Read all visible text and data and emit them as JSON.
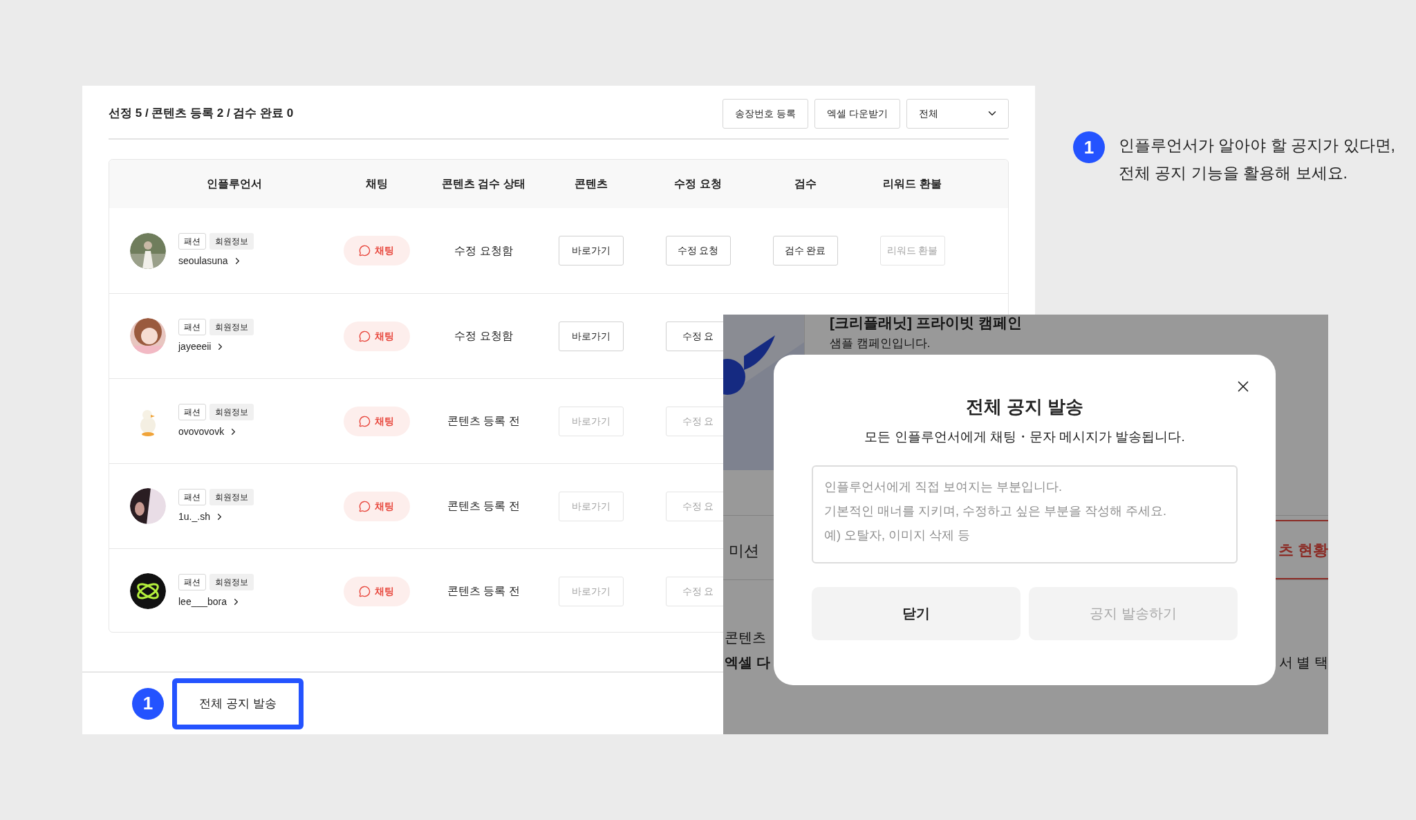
{
  "summary": "선정 5 / 콘텐츠 등록 2 / 검수 완료 0",
  "toolbar": {
    "buttons": [
      "송장번호 등록",
      "엑셀 다운받기"
    ],
    "filter": {
      "value": "전체"
    }
  },
  "table": {
    "columns": [
      "인플루언서",
      "채팅",
      "콘텐츠 검수 상태",
      "콘텐츠",
      "수정 요청",
      "검수",
      "리워드 환불"
    ],
    "rows": [
      {
        "category": "패션",
        "info_tag": "회원정보",
        "username": "seoulasuna",
        "chat": "채팅",
        "status": "수정 요청함",
        "actions": [
          {
            "label": "바로가기",
            "disabled": false
          },
          {
            "label": "수정 요청",
            "disabled": false
          },
          {
            "label": "검수 완료",
            "disabled": false
          },
          {
            "label": "리워드 환불",
            "disabled": true
          }
        ]
      },
      {
        "category": "패션",
        "info_tag": "회원정보",
        "username": "jayeeeii",
        "chat": "채팅",
        "status": "수정 요청함",
        "actions": [
          {
            "label": "바로가기",
            "disabled": false
          },
          {
            "label": "수정 요",
            "disabled": false
          }
        ]
      },
      {
        "category": "패션",
        "info_tag": "회원정보",
        "username": "ovovovovk",
        "chat": "채팅",
        "status": "콘텐츠 등록 전",
        "actions": [
          {
            "label": "바로가기",
            "disabled": true
          },
          {
            "label": "수정 요",
            "disabled": true
          }
        ]
      },
      {
        "category": "패션",
        "info_tag": "회원정보",
        "username": "1u._.sh",
        "chat": "채팅",
        "status": "콘텐츠 등록 전",
        "actions": [
          {
            "label": "바로가기",
            "disabled": true
          },
          {
            "label": "수정 요",
            "disabled": true
          }
        ]
      },
      {
        "category": "패션",
        "info_tag": "회원정보",
        "username": "lee___bora",
        "chat": "채팅",
        "status": "콘텐츠 등록 전",
        "actions": [
          {
            "label": "바로가기",
            "disabled": true
          },
          {
            "label": "수정 요",
            "disabled": true
          }
        ]
      }
    ]
  },
  "bottom_bar": {
    "step": "1",
    "button": "전체 공지 발송"
  },
  "overlay": {
    "behind": {
      "title": "[크리플래닛] 프라이빗 캠페인",
      "subtitle": "샘플 캠페인입니다.",
      "tab_left": "미션",
      "tab_right": "츠 현황",
      "line_1": "콘텐츠",
      "line_2": "엑셀 다",
      "line_2_right": "서 별 택"
    },
    "modal": {
      "title": "전체 공지 발송",
      "subtitle": "모든 인플루언서에게 채팅・문자 메시지가 발송됩니다.",
      "placeholder": "인플루언서에게 직접 보여지는 부분입니다.\n기본적인 매너를 지키며, 수정하고 싶은 부분을 작성해 주세요.\n예) 오탈자, 이미지 삭제 등",
      "buttons": [
        {
          "label": "닫기",
          "disabled": false
        },
        {
          "label": "공지 발송하기",
          "disabled": true
        }
      ]
    }
  },
  "annotation": {
    "step": "1",
    "text": "인플루언서가 알아야 할 공지가 있다면,\n전체 공지 기능을 활용해 보세요."
  }
}
